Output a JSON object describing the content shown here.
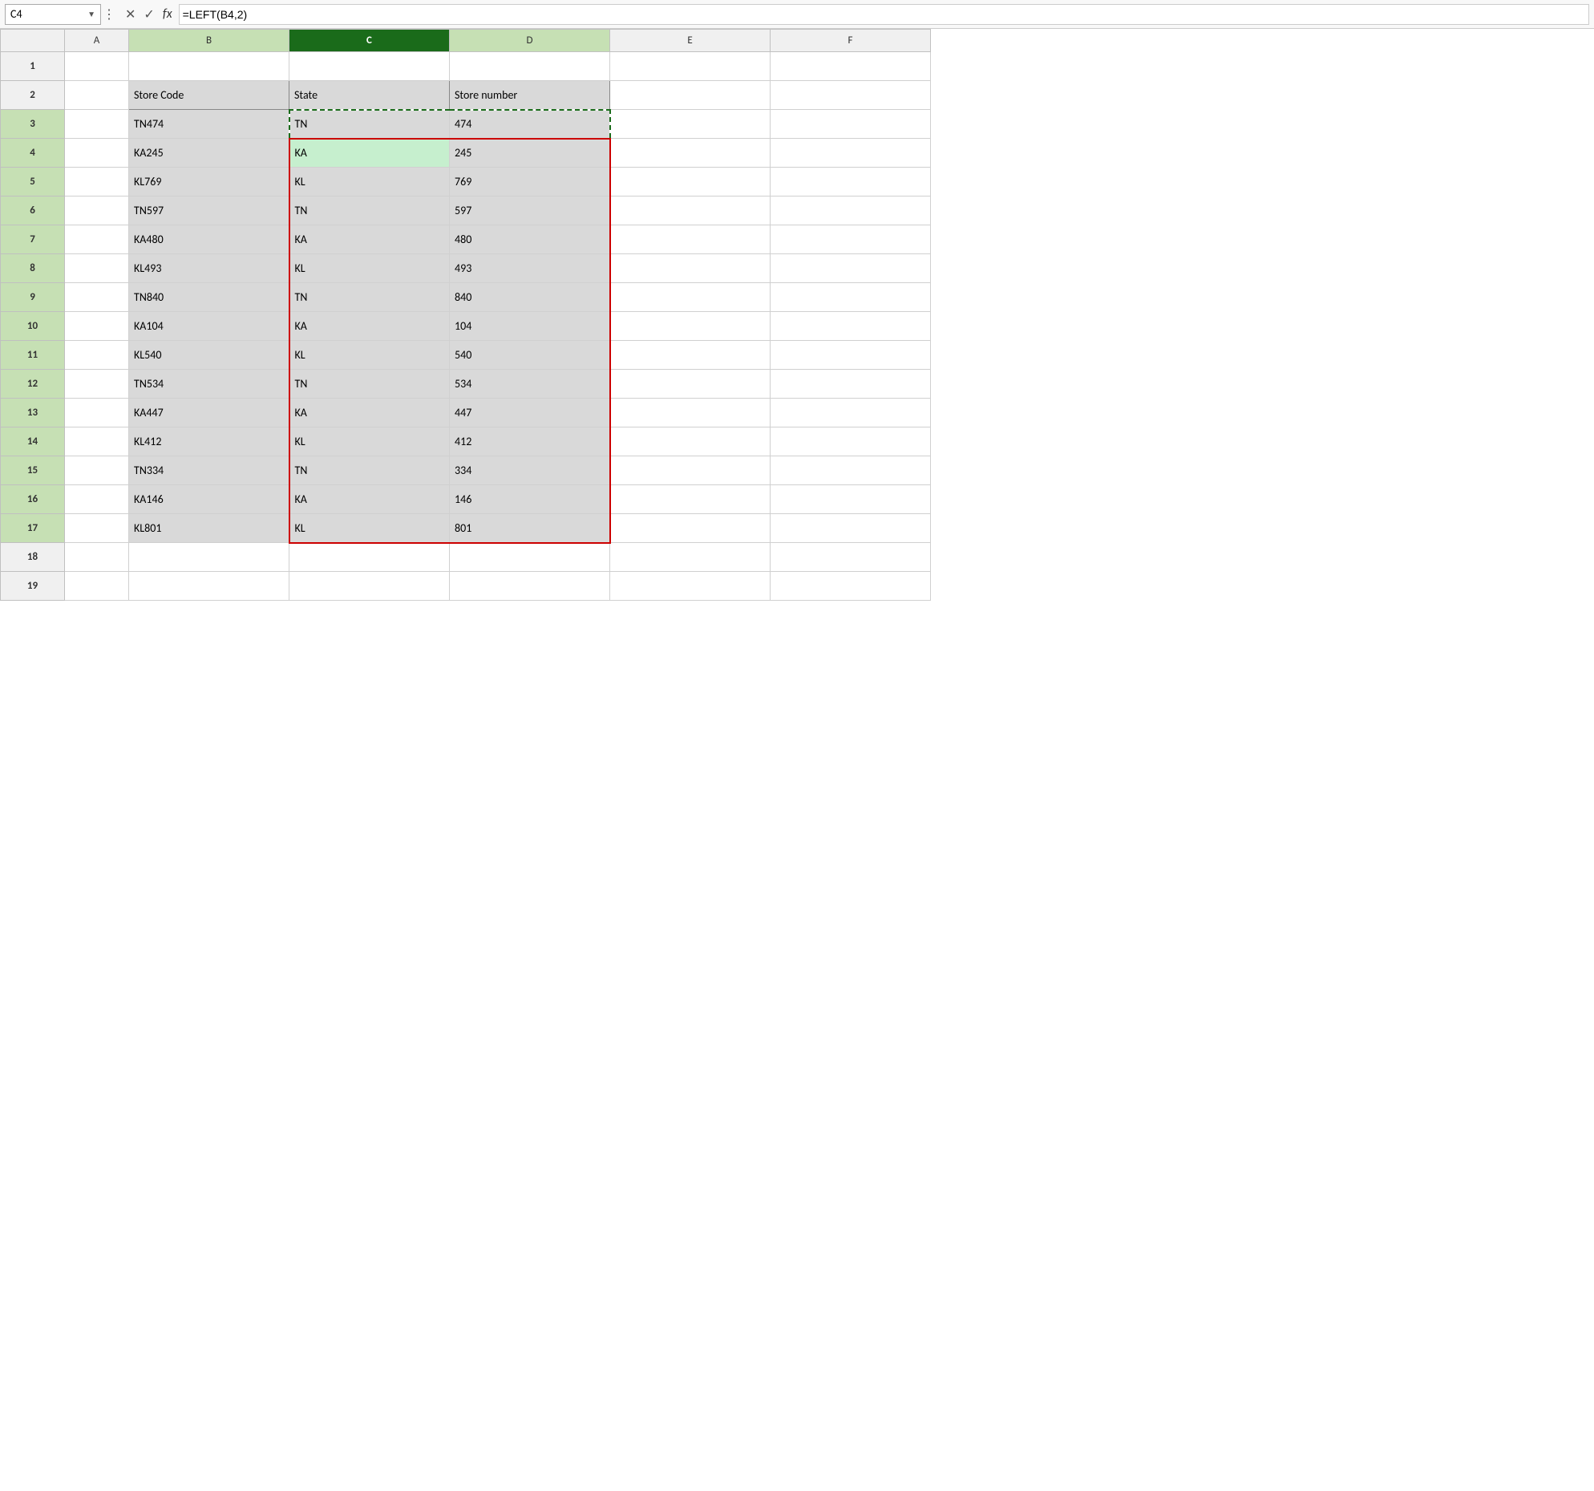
{
  "formulaBar": {
    "cellName": "C4",
    "dropdownArrow": "▼",
    "crossBtn": "✕",
    "checkBtn": "✓",
    "fxLabel": "fx",
    "formula": "=LEFT(B4,2)"
  },
  "columns": [
    "",
    "A",
    "B",
    "C",
    "D",
    "E",
    "F"
  ],
  "rows": [
    {
      "rowNum": 1,
      "cells": [
        "",
        "",
        "",
        "",
        "",
        ""
      ]
    },
    {
      "rowNum": 2,
      "cells": [
        "",
        "Store Code",
        "State",
        "Store number",
        "",
        ""
      ]
    },
    {
      "rowNum": 3,
      "cells": [
        "",
        "TN474",
        "TN",
        "474",
        "",
        ""
      ]
    },
    {
      "rowNum": 4,
      "cells": [
        "",
        "KA245",
        "KA",
        "245",
        "",
        ""
      ]
    },
    {
      "rowNum": 5,
      "cells": [
        "",
        "KL769",
        "KL",
        "769",
        "",
        ""
      ]
    },
    {
      "rowNum": 6,
      "cells": [
        "",
        "TN597",
        "TN",
        "597",
        "",
        ""
      ]
    },
    {
      "rowNum": 7,
      "cells": [
        "",
        "KA480",
        "KA",
        "480",
        "",
        ""
      ]
    },
    {
      "rowNum": 8,
      "cells": [
        "",
        "KL493",
        "KL",
        "493",
        "",
        ""
      ]
    },
    {
      "rowNum": 9,
      "cells": [
        "",
        "TN840",
        "TN",
        "840",
        "",
        ""
      ]
    },
    {
      "rowNum": 10,
      "cells": [
        "",
        "KA104",
        "KA",
        "104",
        "",
        ""
      ]
    },
    {
      "rowNum": 11,
      "cells": [
        "",
        "KL540",
        "KL",
        "540",
        "",
        ""
      ]
    },
    {
      "rowNum": 12,
      "cells": [
        "",
        "TN534",
        "TN",
        "534",
        "",
        ""
      ]
    },
    {
      "rowNum": 13,
      "cells": [
        "",
        "KA447",
        "KA",
        "447",
        "",
        ""
      ]
    },
    {
      "rowNum": 14,
      "cells": [
        "",
        "KL412",
        "KL",
        "412",
        "",
        ""
      ]
    },
    {
      "rowNum": 15,
      "cells": [
        "",
        "TN334",
        "TN",
        "334",
        "",
        ""
      ]
    },
    {
      "rowNum": 16,
      "cells": [
        "",
        "KA146",
        "KA",
        "146",
        "",
        ""
      ]
    },
    {
      "rowNum": 17,
      "cells": [
        "",
        "KL801",
        "KL",
        "801",
        "",
        ""
      ]
    },
    {
      "rowNum": 18,
      "cells": [
        "",
        "",
        "",
        "",
        "",
        ""
      ]
    },
    {
      "rowNum": 19,
      "cells": [
        "",
        "",
        "",
        "",
        "",
        ""
      ]
    }
  ]
}
